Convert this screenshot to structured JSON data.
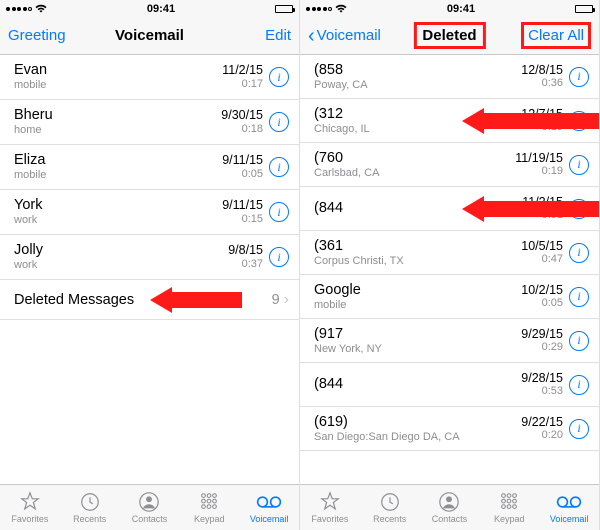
{
  "statusbar": {
    "time": "09:41"
  },
  "left": {
    "nav": {
      "left": "Greeting",
      "title": "Voicemail",
      "right": "Edit"
    },
    "rows": [
      {
        "name": "Evan",
        "sub": "mobile",
        "date": "11/2/15",
        "dur": "0:17"
      },
      {
        "name": "Bheru",
        "sub": "home",
        "date": "9/30/15",
        "dur": "0:18"
      },
      {
        "name": "Eliza",
        "sub": "mobile",
        "date": "9/11/15",
        "dur": "0:05"
      },
      {
        "name": "York",
        "sub": "work",
        "date": "9/11/15",
        "dur": "0:15"
      },
      {
        "name": "Jolly",
        "sub": "work",
        "date": "9/8/15",
        "dur": "0:37"
      }
    ],
    "deleted": {
      "label": "Deleted Messages",
      "count": "9"
    }
  },
  "right": {
    "nav": {
      "left": "Voicemail",
      "title": "Deleted",
      "right": "Clear All"
    },
    "rows": [
      {
        "name": "(858",
        "sub": "Poway, CA",
        "date": "12/8/15",
        "dur": "0:36"
      },
      {
        "name": "(312",
        "sub": "Chicago, IL",
        "date": "12/7/15",
        "dur": "0:19"
      },
      {
        "name": "(760",
        "sub": "Carlsbad, CA",
        "date": "11/19/15",
        "dur": "0:19"
      },
      {
        "name": "(844",
        "sub": "",
        "date": "11/2/15",
        "dur": "0:51"
      },
      {
        "name": "(361",
        "sub": "Corpus Christi, TX",
        "date": "10/5/15",
        "dur": "0:47"
      },
      {
        "name": "Google",
        "sub": "mobile",
        "date": "10/2/15",
        "dur": "0:05"
      },
      {
        "name": "(917",
        "sub": "New York, NY",
        "date": "9/29/15",
        "dur": "0:29"
      },
      {
        "name": "(844",
        "sub": "",
        "date": "9/28/15",
        "dur": "0:53"
      },
      {
        "name": "(619)",
        "sub": "San Diego:San Diego DA, CA",
        "date": "9/22/15",
        "dur": "0:20"
      }
    ]
  },
  "tabs": {
    "favorites": "Favorites",
    "recents": "Recents",
    "contacts": "Contacts",
    "keypad": "Keypad",
    "voicemail": "Voicemail"
  }
}
